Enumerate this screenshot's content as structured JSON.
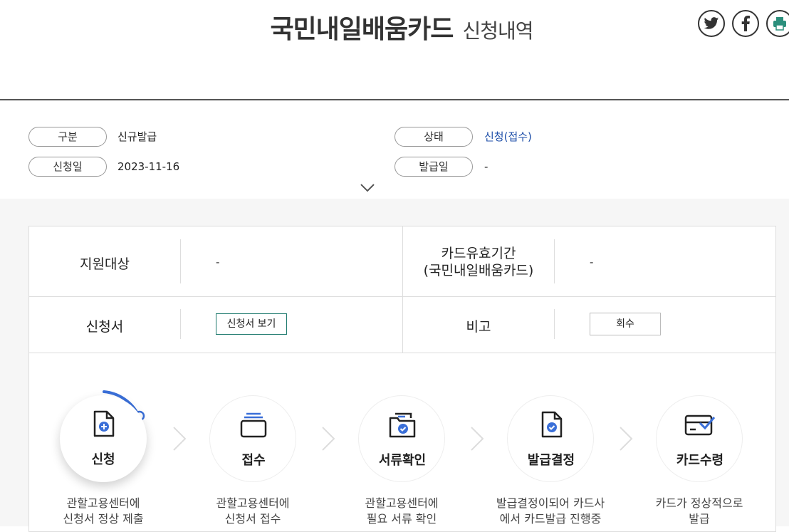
{
  "header": {
    "title_main": "국민내일배움카드",
    "title_sub": "신청내역"
  },
  "share": [
    {
      "icon": "twitter-icon"
    },
    {
      "icon": "facebook-icon"
    },
    {
      "icon": "print-icon"
    }
  ],
  "summary": {
    "type_label": "구분",
    "type_value": "신규발급",
    "status_label": "상태",
    "status_value": "신청(접수)",
    "apply_date_label": "신청일",
    "apply_date_value": "2023-11-16",
    "issue_date_label": "발급일",
    "issue_date_value": "-"
  },
  "details": {
    "target_label": "지원대상",
    "target_value": "-",
    "validity_label_1": "카드유효기간",
    "validity_label_2": "(국민내일배움카드)",
    "validity_value": "-",
    "application_label": "신청서",
    "view_button": "신청서 보기",
    "note_label": "비고",
    "recall_button": "회수"
  },
  "steps": [
    {
      "label": "신청",
      "desc1": "관할고용센터에",
      "desc2": "신청서 정상 제출",
      "icon": "document-plus-icon",
      "active": true
    },
    {
      "label": "접수",
      "desc1": "관할고용센터에",
      "desc2": "신청서 접수",
      "icon": "tray-icon",
      "active": false
    },
    {
      "label": "서류확인",
      "desc1": "관할고용센터에",
      "desc2": "필요 서류 확인",
      "icon": "folder-check-icon",
      "active": false
    },
    {
      "label": "발급결정",
      "desc1": "발급결정이되어 카드사",
      "desc2": "에서 카드발급 진행중",
      "icon": "document-check-icon",
      "active": false
    },
    {
      "label": "카드수령",
      "desc1": "카드가 정상적으로",
      "desc2": "발급",
      "icon": "card-check-icon",
      "active": false
    }
  ],
  "colors": {
    "accent_blue": "#3a6fd8",
    "status_blue": "#1d4ea8",
    "view_border": "#1e7a6e",
    "share_green": "#2b8f7c"
  }
}
